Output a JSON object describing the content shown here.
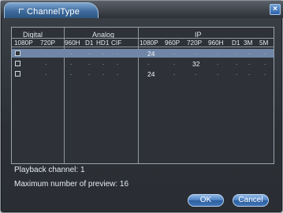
{
  "window": {
    "title": "ChannelType",
    "close_symbol": "×"
  },
  "groups": {
    "digital": "Digital",
    "analog": "Analog",
    "ip": "IP"
  },
  "columns": [
    "1080P",
    "720P",
    "960H",
    "D1",
    "HD1",
    "CIF",
    "1080P",
    "960P",
    "720P",
    "960H",
    "D1",
    "3M",
    "5M"
  ],
  "rows": [
    {
      "selected": true,
      "checked": false,
      "values": {
        "ip_1080p": "24"
      }
    },
    {
      "selected": false,
      "checked": false,
      "values": {
        "ip_720p": "32"
      }
    },
    {
      "selected": false,
      "checked": false,
      "values": {
        "ip_1080p": "24"
      }
    }
  ],
  "dot": ".",
  "info": {
    "playback": "Playback channel: 1",
    "preview": "Maximum number of preview: 16"
  },
  "buttons": {
    "ok": "OK",
    "cancel": "Cancel"
  }
}
